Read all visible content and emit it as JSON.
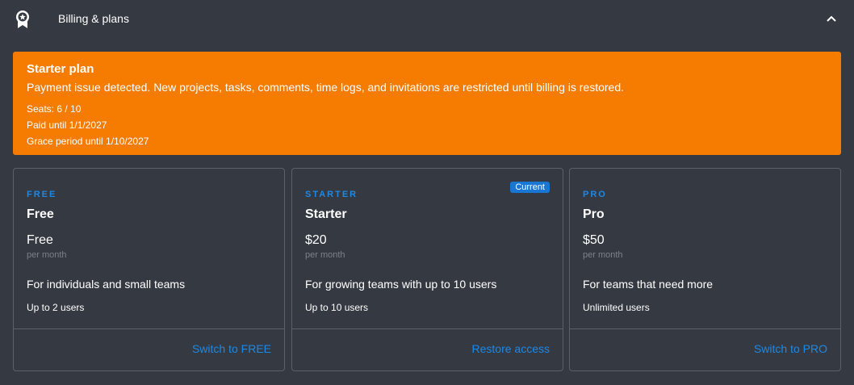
{
  "header": {
    "title": "Billing & plans",
    "icon": "award-badge-icon",
    "collapse_icon": "chevron-up-icon"
  },
  "alert": {
    "title": "Starter plan",
    "message": "Payment issue detected. New projects, tasks, comments, time logs, and invitations are restricted until billing is restored.",
    "seats": "Seats: 6 / 10",
    "paid_until": "Paid until 1/1/2027",
    "grace_period": "Grace period until 1/10/2027",
    "color": "#f57c00"
  },
  "plans": [
    {
      "tier": "FREE",
      "name": "Free",
      "price": "Free",
      "period": "per month",
      "description": "For individuals and small teams",
      "limit": "Up to 2 users",
      "action": "Switch to FREE",
      "current": false
    },
    {
      "tier": "STARTER",
      "name": "Starter",
      "price": "$20",
      "period": "per month",
      "description": "For growing teams with up to 10 users",
      "limit": "Up to 10 users",
      "action": "Restore access",
      "current": true,
      "badge": "Current"
    },
    {
      "tier": "PRO",
      "name": "Pro",
      "price": "$50",
      "period": "per month",
      "description": "For teams that need more",
      "limit": "Unlimited users",
      "action": "Switch to PRO",
      "current": false
    }
  ],
  "colors": {
    "background": "#353a42",
    "accent": "#1e88e5",
    "warning": "#f57c00",
    "badge": "#1976d2"
  }
}
